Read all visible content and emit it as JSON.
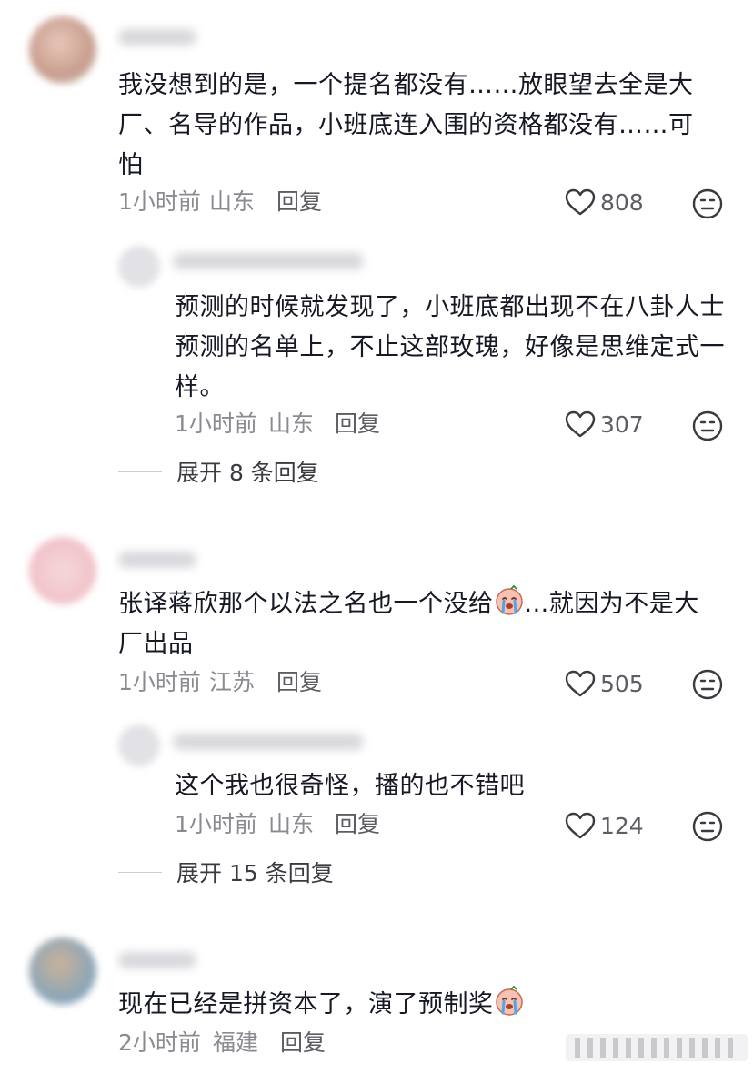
{
  "comments": [
    {
      "text": "我没想到的是，一个提名都没有……放眼望去全是大厂、名导的作品，小班底连入围的资格都没有……可怕",
      "time": "1小时前",
      "location": "山东",
      "reply_label": "回复",
      "likes": "808",
      "reply": {
        "text": "预测的时候就发现了，小班底都出现不在八卦人士预测的名单上，不止这部玫瑰，好像是思维定式一样。",
        "time": "1小时前",
        "location": "山东",
        "reply_label": "回复",
        "likes": "307"
      },
      "expand_label": "展开 8 条回复"
    },
    {
      "text_before_emoji": "张译蒋欣那个以法之名也一个没给",
      "text_after_emoji": "...就因为不是大厂出品",
      "time": "1小时前",
      "location": "江苏",
      "reply_label": "回复",
      "likes": "505",
      "reply": {
        "text": "这个我也很奇怪，播的也不错吧",
        "time": "1小时前",
        "location": "山东",
        "reply_label": "回复",
        "likes": "124"
      },
      "expand_label": "展开 15 条回复"
    },
    {
      "text_before_emoji": "现在已经是拼资本了，演了预制奖",
      "time": "2小时前",
      "location": "福建",
      "reply_label": "回复"
    }
  ],
  "icons": {
    "like": "heart-outline-icon",
    "dislike": "neutral-face-icon",
    "inline_emoji": "crying-face-emoji"
  }
}
